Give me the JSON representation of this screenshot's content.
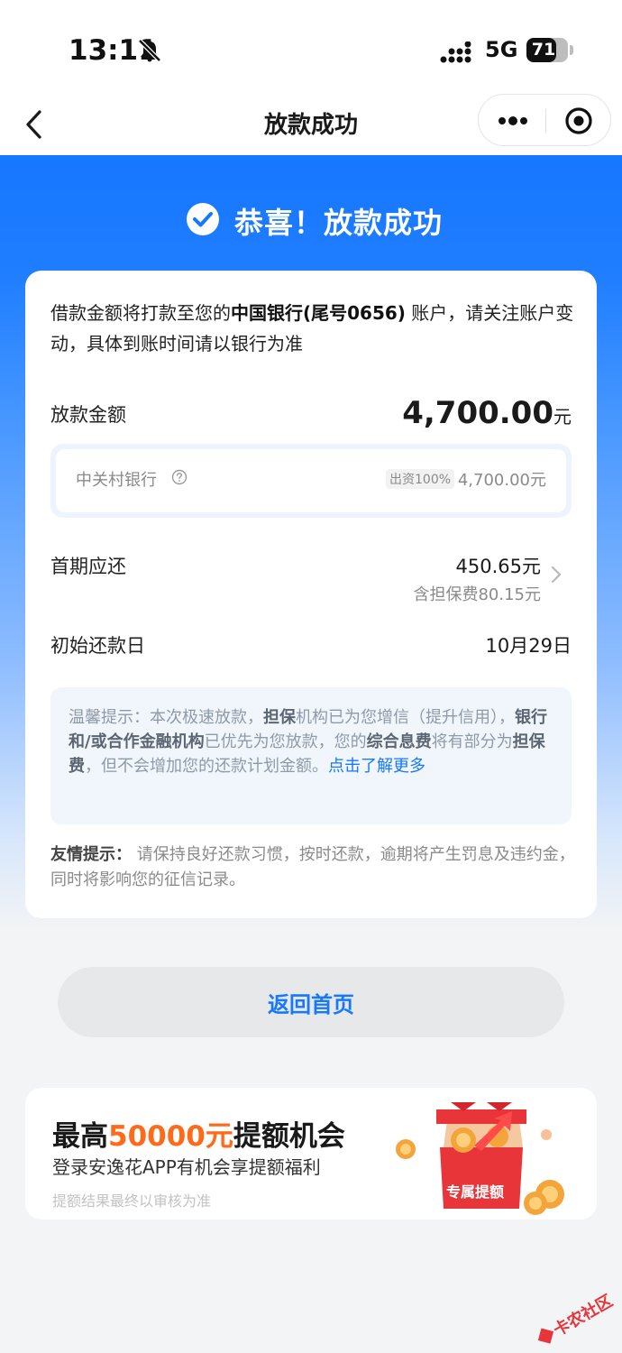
{
  "status_bar": {
    "time": "13:11",
    "network": "5G",
    "battery": "71",
    "battery_level": 0.71
  },
  "nav": {
    "title": "放款成功"
  },
  "hero": {
    "title": "恭喜！放款成功"
  },
  "card": {
    "notice_prefix": "借款金额将打款至您的",
    "notice_bank": "中国银行(尾号0656)",
    "notice_suffix": " 账户，请关注账户变动，具体到账时间请以银行为准",
    "loan_label": "放款金额",
    "loan_amount": "4,700.00",
    "loan_unit": "元",
    "lender_name": "中关村银行",
    "lender_share": "出资100%",
    "lender_amount": "4,700.00元",
    "first_label": "首期应还",
    "first_amount": "450.65元",
    "first_fee": "含担保费80.15元",
    "due_label": "初始还款日",
    "due_date": "10月29日",
    "tip_prefix": "温馨提示：本次极速放款，",
    "tip_b1": "担保",
    "tip_mid1": "机构已为您增信（提升信用），",
    "tip_b2": "银行和/或合作金融机构",
    "tip_mid2": "已优先为您放款，您的",
    "tip_b3": "综合息费",
    "tip_mid3": "将有部分为",
    "tip_b4": "担保费",
    "tip_mid4": "，但不会增加您的还款计划金额。",
    "tip_link": "点击了解更多",
    "friendly_label": "友情提示：",
    "friendly_text": " 请保持良好还款习惯，按时还款，逾期将产生罚息及违约金，同时将影响您的征信记录。"
  },
  "home_button": "返回首页",
  "promo": {
    "title_prefix": "最高",
    "title_highlight": "50000元",
    "title_suffix": "提额机会",
    "subtitle": "登录安逸花APP有机会享提额福利",
    "note": "提额结果最终以审核为准",
    "gift_label": "专属提额"
  },
  "watermark": "卡农社区",
  "colors": {
    "primary": "#1677ff",
    "accent_orange": "#ff6a1a",
    "gift_red": "#e8353a"
  }
}
